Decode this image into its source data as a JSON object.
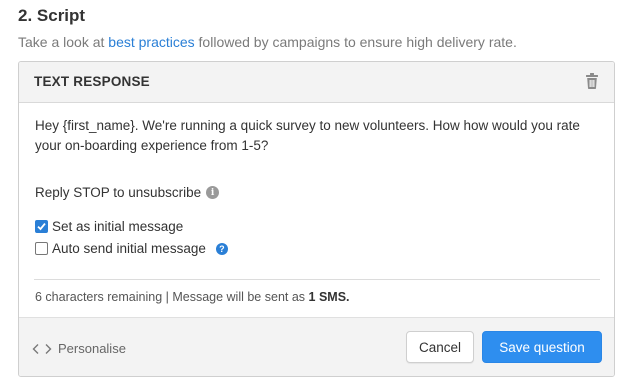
{
  "section": {
    "title": "2. Script",
    "subtitle_prefix": "Take a look at ",
    "subtitle_link": "best practices",
    "subtitle_suffix": " followed by campaigns to ensure high delivery rate."
  },
  "card": {
    "title": "TEXT RESPONSE",
    "delete_icon": "trash-icon",
    "message": "Hey {first_name}. We're running a quick survey to new volunteers.  How how would you rate your on-boarding experience from 1-5?",
    "stop_text": "Reply STOP to unsubscribe",
    "checkboxes": [
      {
        "label": "Set as initial message",
        "checked": true
      },
      {
        "label": "Auto send initial message",
        "checked": false
      }
    ],
    "remaining_prefix": "6 characters remaining | Message will be sent as ",
    "remaining_count": "1 SMS."
  },
  "footer": {
    "personalise_label": "Personalise",
    "cancel_label": "Cancel",
    "save_label": "Save question"
  },
  "colors": {
    "accent": "#2e8eef",
    "link": "#2a7fd6",
    "header_bg": "#f3f3f3"
  }
}
